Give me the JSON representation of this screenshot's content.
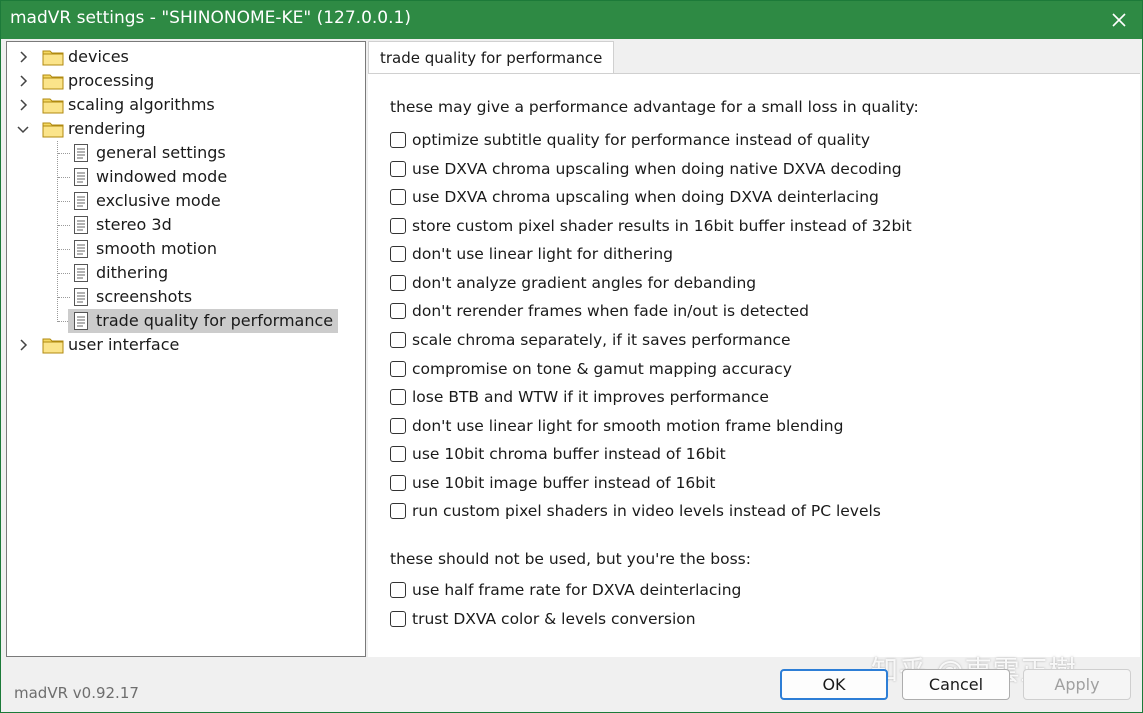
{
  "window": {
    "title": "madVR settings - \"SHINONOME-KE\" (127.0.0.1)",
    "accent": "#2e8a44"
  },
  "tree": {
    "items": [
      {
        "label": "devices",
        "type": "folder",
        "expanded": false
      },
      {
        "label": "processing",
        "type": "folder",
        "expanded": false
      },
      {
        "label": "scaling algorithms",
        "type": "folder",
        "expanded": false
      },
      {
        "label": "rendering",
        "type": "folder",
        "expanded": true
      },
      {
        "label": "general settings",
        "type": "page"
      },
      {
        "label": "windowed mode",
        "type": "page"
      },
      {
        "label": "exclusive mode",
        "type": "page"
      },
      {
        "label": "stereo 3d",
        "type": "page"
      },
      {
        "label": "smooth motion",
        "type": "page"
      },
      {
        "label": "dithering",
        "type": "page"
      },
      {
        "label": "screenshots",
        "type": "page"
      },
      {
        "label": "trade quality for performance",
        "type": "page",
        "selected": true
      },
      {
        "label": "user interface",
        "type": "folder",
        "expanded": false
      }
    ]
  },
  "tab": {
    "label": "trade quality for performance"
  },
  "groups": [
    {
      "heading": "these may give a performance advantage for a small loss in quality:",
      "options": [
        {
          "label": "optimize subtitle quality for performance instead of quality",
          "checked": false
        },
        {
          "label": "use DXVA chroma upscaling when doing native DXVA decoding",
          "checked": false
        },
        {
          "label": "use DXVA chroma upscaling when doing DXVA deinterlacing",
          "checked": false
        },
        {
          "label": "store custom pixel shader results in 16bit buffer instead of 32bit",
          "checked": false
        },
        {
          "label": "don't use linear light for dithering",
          "checked": false
        },
        {
          "label": "don't analyze gradient angles for debanding",
          "checked": false
        },
        {
          "label": "don't rerender frames when fade in/out is detected",
          "checked": false
        },
        {
          "label": "scale chroma separately, if it saves performance",
          "checked": false
        },
        {
          "label": "compromise on tone & gamut mapping accuracy",
          "checked": false
        },
        {
          "label": "lose BTB and WTW if it improves performance",
          "checked": false
        },
        {
          "label": "don't use linear light for smooth motion frame blending",
          "checked": false
        },
        {
          "label": "use 10bit chroma buffer instead of 16bit",
          "checked": false
        },
        {
          "label": "use 10bit image buffer instead of 16bit",
          "checked": false
        },
        {
          "label": "run custom pixel shaders in video levels instead of PC levels",
          "checked": false
        }
      ]
    },
    {
      "heading": "these should not be used, but you're the boss:",
      "options": [
        {
          "label": "use half frame rate for DXVA deinterlacing",
          "checked": false
        },
        {
          "label": "trust DXVA color & levels conversion",
          "checked": false
        }
      ]
    }
  ],
  "footer": {
    "version": "madVR v0.92.17",
    "ok_label": "OK",
    "cancel_label": "Cancel",
    "apply_label": "Apply",
    "apply_enabled": false
  },
  "watermark": "知乎 @東雲正樹"
}
